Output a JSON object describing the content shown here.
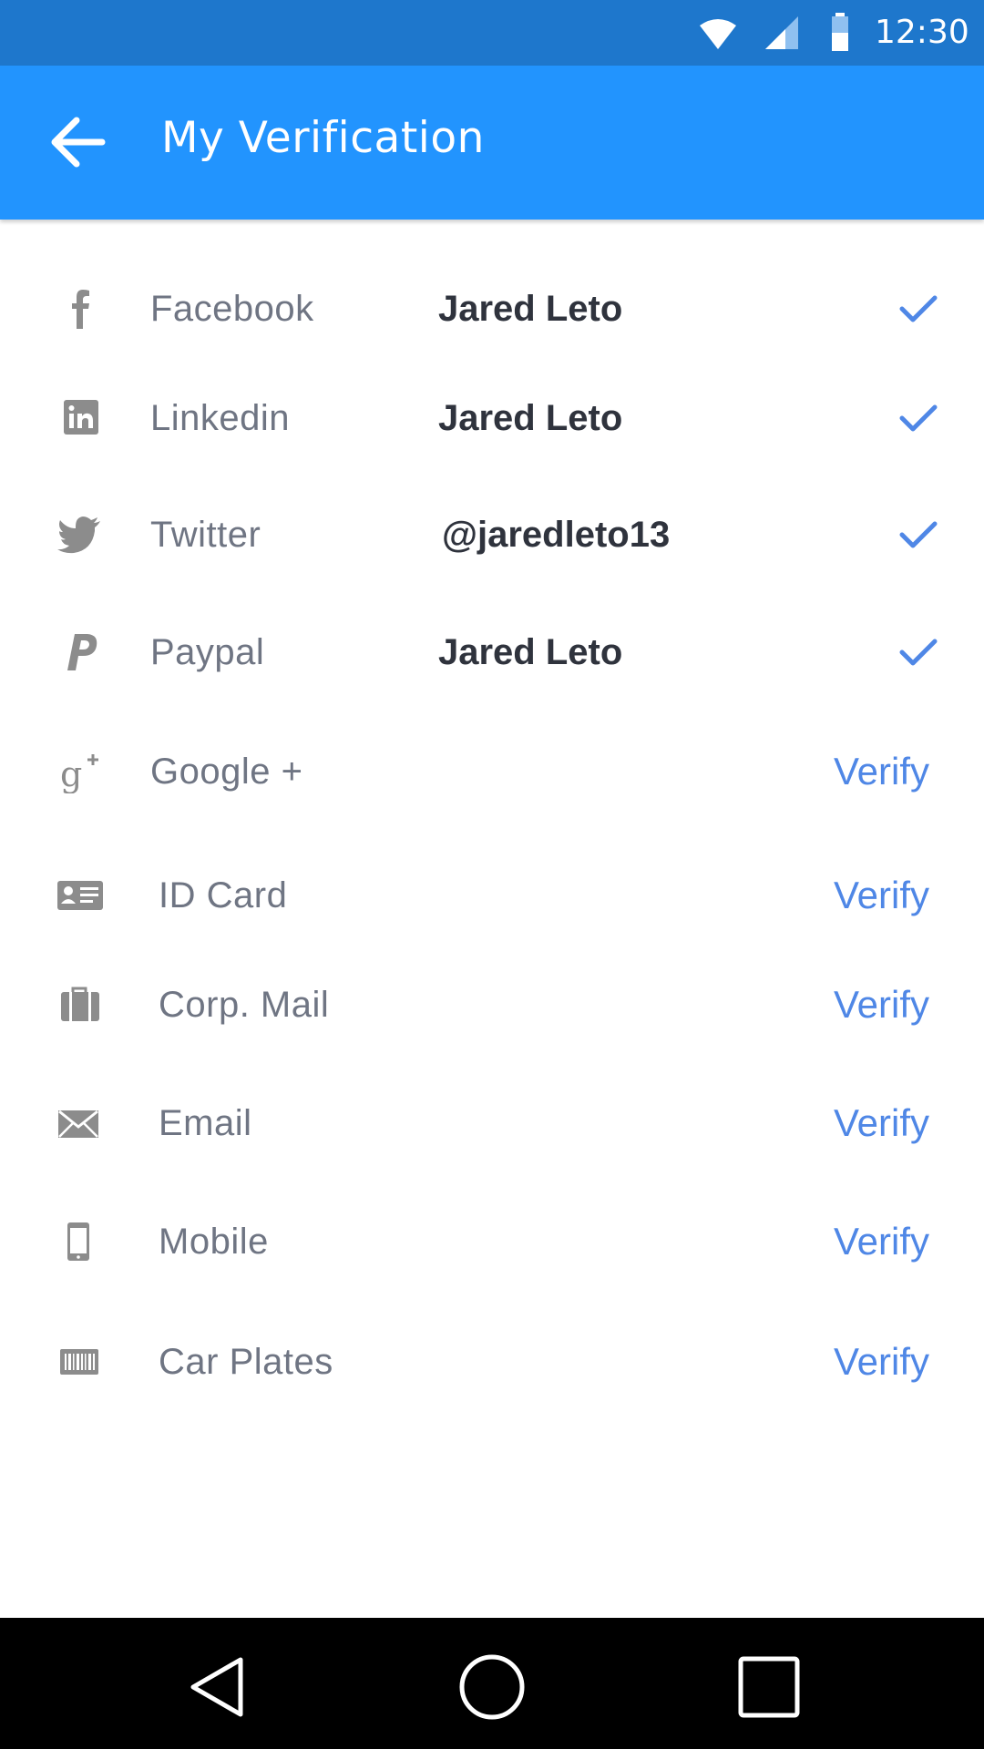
{
  "status_bar": {
    "time": "12:30",
    "icons": [
      "wifi-icon",
      "cell-signal-icon",
      "battery-icon"
    ]
  },
  "app_bar": {
    "title": "My Verification",
    "back_icon": "arrow-left-icon",
    "color": "#2294fe"
  },
  "verifications": [
    {
      "label": "Facebook",
      "value": "Jared Leto",
      "icon": "facebook-icon",
      "verified": true
    },
    {
      "label": "Linkedin",
      "value": "Jared Leto",
      "icon": "linkedin-icon",
      "verified": true
    },
    {
      "label": "Twitter",
      "value": "@jaredleto13",
      "icon": "twitter-icon",
      "verified": true
    },
    {
      "label": "Paypal",
      "value": "Jared Leto",
      "icon": "paypal-icon",
      "verified": true
    },
    {
      "label": "Google +",
      "action": "Verify",
      "icon": "google-plus-icon",
      "verified": false
    },
    {
      "label": "ID Card",
      "action": "Verify",
      "icon": "id-card-icon",
      "verified": false
    },
    {
      "label": "Corp. Mail",
      "action": "Verify",
      "icon": "briefcase-icon",
      "verified": false
    },
    {
      "label": "Email",
      "action": "Verify",
      "icon": "envelope-icon",
      "verified": false
    },
    {
      "label": "Mobile",
      "action": "Verify",
      "icon": "mobile-phone-icon",
      "verified": false
    },
    {
      "label": "Car Plates",
      "action": "Verify",
      "icon": "barcode-icon",
      "verified": false
    }
  ],
  "colors": {
    "status_bar": "#1e77cc",
    "accent": "#4f87e6",
    "label": "#6f7583",
    "value": "#2f333d",
    "icon": "#8c8c8c"
  },
  "nav_bar": {
    "buttons": [
      "nav-back-icon",
      "nav-home-icon",
      "nav-recents-icon"
    ]
  }
}
